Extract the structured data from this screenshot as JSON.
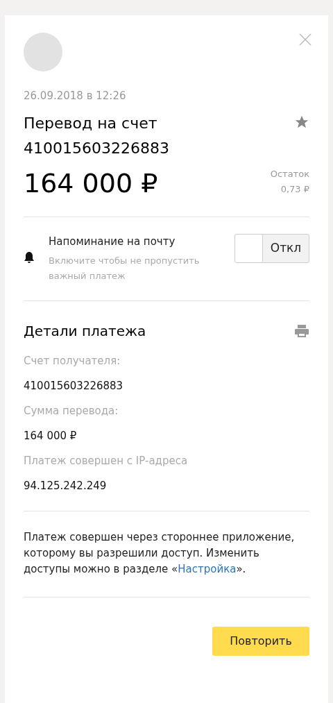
{
  "date": "26.09.2018 в 12:26",
  "title": [
    "Перевод на счет",
    "410015603226883"
  ],
  "amount": "164 000 ₽",
  "balance": {
    "label": "Остаток",
    "value": "0,73 ₽"
  },
  "reminder": {
    "title": "Напоминание на почту",
    "hint": "Включите чтобы не пропустить важный платеж",
    "toggle": {
      "on": false,
      "label": "Откл"
    }
  },
  "details": {
    "heading": "Детали платежа",
    "fields": [
      {
        "label": "Счет получателя:",
        "value": "410015603226883"
      },
      {
        "label": "Сумма перевода:",
        "value": "164 000 ₽"
      },
      {
        "label": "Платеж совершен с IP-адреса",
        "value": "94.125.242.249"
      }
    ]
  },
  "notice": {
    "text": "Платеж совершен через стороннее приложение, которому вы разрешили доступ. Изменить доступы можно в разделе «",
    "link": "Настройка",
    "after": "»."
  },
  "repeat_button": "Повторить"
}
